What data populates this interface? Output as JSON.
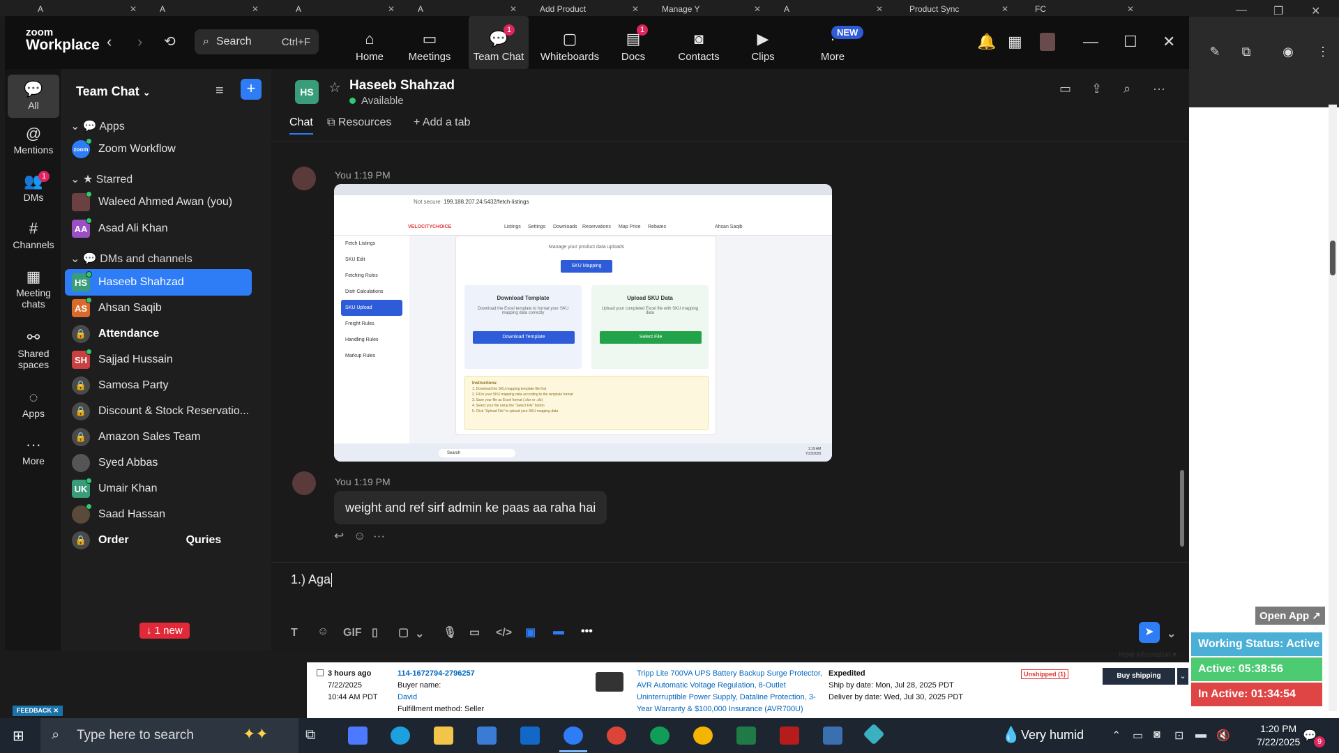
{
  "browser": {
    "tabs": [
      "A",
      "A",
      "A",
      "A",
      "Add Product",
      "Manage Y",
      "A",
      "Product Sync",
      "FC"
    ]
  },
  "zoom": {
    "logo_top": "zoom",
    "logo_bottom": "Workplace",
    "search_label": "Search",
    "search_shortcut": "Ctrl+F",
    "nav": [
      {
        "label": "Home",
        "icon": "home-icon"
      },
      {
        "label": "Meetings",
        "icon": "video-icon"
      },
      {
        "label": "Team Chat",
        "icon": "chat-icon",
        "badge": "1"
      },
      {
        "label": "Whiteboards",
        "icon": "whiteboard-icon"
      },
      {
        "label": "Docs",
        "icon": "doc-icon",
        "badge": "1"
      },
      {
        "label": "Contacts",
        "icon": "contacts-icon"
      },
      {
        "label": "Clips",
        "icon": "clips-icon"
      },
      {
        "label": "More",
        "icon": "more-icon"
      }
    ],
    "new_label": "NEW",
    "rail": [
      {
        "label": "All"
      },
      {
        "label": "Mentions"
      },
      {
        "label": "DMs",
        "badge": "1"
      },
      {
        "label": "Channels"
      },
      {
        "label": "Meeting chats"
      },
      {
        "label": "Shared spaces"
      },
      {
        "label": "Apps"
      },
      {
        "label": "More"
      }
    ],
    "sidebar": {
      "title": "Team Chat",
      "sections": {
        "apps": "Apps",
        "starred": "Starred",
        "dms": "DMs and channels"
      },
      "apps_item": "Zoom Workflow",
      "starred": [
        "Waleed Ahmed Awan (you)",
        "Asad Ali Khan"
      ],
      "dms": [
        "Haseeb Shahzad",
        "Ahsan Saqib",
        "Attendance",
        "Sajjad Hussain",
        "Samosa Party",
        "Discount & Stock Reservatio...",
        "Amazon Sales Team",
        "Syed Abbas",
        "Umair Khan",
        "Saad Hassan",
        "Order",
        "Quries"
      ],
      "new_banner": "↓ 1 new",
      "initials": {
        "aa": "AA",
        "hs": "HS",
        "as": "AS",
        "sh": "SH",
        "uk": "UK",
        "zoom": "zoom"
      }
    },
    "chat": {
      "initials": "HS",
      "name": "Haseeb Shahzad",
      "status": "Available",
      "tabs": [
        "Chat",
        "Resources",
        "Add a tab"
      ],
      "messages": [
        {
          "meta": "You 1:19 PM"
        },
        {
          "meta": "You 1:19 PM",
          "text": "weight and ref sirf admin ke paas aa raha hai"
        }
      ],
      "compose_text": "1.) Aga",
      "toolbar": [
        "T",
        "GIF",
        "</>"
      ],
      "screenshot": {
        "url": "199.188.207.24:5432/fetch-listings",
        "not_secure": "Not secure",
        "brand": "VELOCITYCHOICE",
        "app_nav": [
          "Listings",
          "Settings",
          "Downloads",
          "Reservations",
          "Map Price",
          "Rebates"
        ],
        "user": "Ahsan Saqib",
        "subtitle": "Manage your product data uploads",
        "sku_button": "SKU Mapping",
        "side": [
          "Fetch Listings",
          "SKU Edit",
          "Fetching Rules",
          "Distr Calculations",
          "SKU Upload",
          "Freight Rules",
          "Handling Rules",
          "Markup Rules"
        ],
        "download_title": "Download Template",
        "download_desc": "Download the Excel template to format your SKU mapping data correctly",
        "download_btn": "Download Template",
        "upload_title": "Upload SKU Data",
        "upload_desc": "Upload your completed Excel file with SKU mapping data",
        "upload_btn": "Select File",
        "instructions_title": "Instructions:",
        "instructions": [
          "1. Download the SKU mapping template file first",
          "2. Fill in your SKU mapping data according to the template format",
          "3. Save your file as Excel format (.xlsx or .xls)",
          "4. Select your file using the \"Select File\" button",
          "5. Click \"Upload File\" to upload your SKU mapping data"
        ],
        "taskbar_search": "Search",
        "time": "1:19 AM",
        "date": "7/23/2025"
      }
    }
  },
  "side_panel": {
    "open_app": "Open App ↗",
    "working_status": "Working Status: Active",
    "active": "Active: 05:38:56",
    "inactive": "In Active: 01:34:54"
  },
  "order": {
    "more_info": "More information ▾",
    "age": "3 hours ago",
    "date": "7/22/2025",
    "time": "10:44 AM PDT",
    "order_id": "114-1672794-2796257",
    "buyer_label": "Buyer name:",
    "buyer": "David",
    "fulfillment": "Fulfillment method: Seller",
    "product": "Tripp Lite 700VA UPS Battery Backup Surge Protector, AVR Automatic Voltage Regulation, 8-Outlet Uninterruptible Power Supply, Dataline Protection, 3-Year Warranty & $100,000 Insurance (AVR700U)",
    "shipping": "Expedited",
    "ship_by": "Ship by date: Mon, Jul 28, 2025 PDT",
    "deliver_by": "Deliver by date: Wed, Jul 30, 2025 PDT",
    "status": "Unshipped (1)",
    "buy_shipping": "Buy shipping",
    "feedback": "FEEDBACK ✕"
  },
  "taskbar": {
    "search_placeholder": "Type here to search",
    "weather": "Very humid",
    "time": "1:20 PM",
    "date": "7/22/2025",
    "notif": "9"
  },
  "colors": {
    "accent": "#2e7cf6",
    "active_green": "#2ecc71",
    "status_green": "#4ccb72",
    "inactive_red": "#e04545"
  }
}
